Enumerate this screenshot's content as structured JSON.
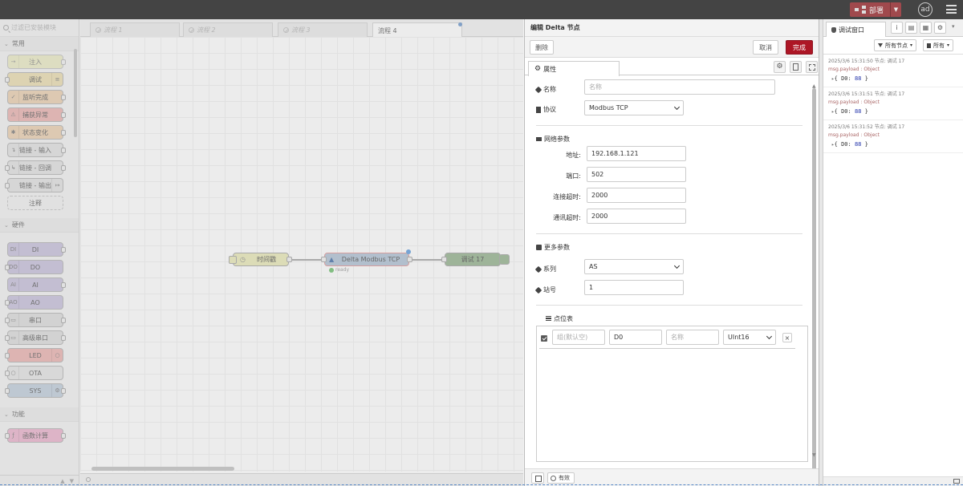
{
  "header": {
    "deploy_label": "部署",
    "user_initials": "ad"
  },
  "palette": {
    "search_placeholder": "过滤已安装模块",
    "categories": [
      {
        "label": "常用",
        "nodes": [
          "注入",
          "调试",
          "监听完成",
          "捕获异常",
          "状态变化",
          "链接 - 输入",
          "链接 - 回调",
          "链接 - 输出",
          "注释"
        ]
      },
      {
        "label": "硬件",
        "nodes": [
          "DI",
          "DO",
          "AI",
          "AO",
          "串口",
          "高级串口",
          "LED",
          "OTA",
          "SYS"
        ]
      },
      {
        "label": "功能",
        "nodes": [
          "函数计算"
        ]
      }
    ]
  },
  "workspace": {
    "tabs": [
      "流程 1",
      "流程 2",
      "流程 3",
      "流程 4"
    ],
    "nodes": {
      "inject": "时间戳",
      "delta": "Delta Modbus TCP",
      "debug": "调试 17"
    },
    "delta_status": "ready"
  },
  "tray": {
    "title": "编辑 Delta 节点",
    "delete_label": "删除",
    "cancel_label": "取消",
    "done_label": "完成",
    "tab_label": "属性",
    "name": {
      "label": "名称",
      "placeholder": "名称",
      "value": ""
    },
    "protocol": {
      "label": "协议",
      "value": "Modbus TCP"
    },
    "network_section": "网络参数",
    "address": {
      "label": "地址:",
      "value": "192.168.1.121"
    },
    "port": {
      "label": "端口:",
      "value": "502"
    },
    "connect_timeout": {
      "label": "连接超时:",
      "value": "2000"
    },
    "comm_timeout": {
      "label": "通讯超时:",
      "value": "2000"
    },
    "more_section": "更多参数",
    "series": {
      "label": "系列",
      "value": "AS"
    },
    "station": {
      "label": "站号",
      "value": "1"
    },
    "points_section": "点位表",
    "points_table": {
      "row": {
        "group_placeholder": "组(默认空)",
        "address": "D0",
        "name_placeholder": "名称",
        "type": "UInt16",
        "checked": true
      }
    },
    "footer_toggle_label": "有效"
  },
  "sidebar": {
    "tab_label": "调试窗口",
    "filter_nodes_label": "所有节点",
    "clear_label": "所有",
    "messages": [
      {
        "meta": "2025/3/6 15:31:50   节点: 调试 17",
        "topic": "msg.payload : Object",
        "key": "D0",
        "value": "88"
      },
      {
        "meta": "2025/3/6 15:31:51   节点: 调试 17",
        "topic": "msg.payload : Object",
        "key": "D0",
        "value": "88"
      },
      {
        "meta": "2025/3/6 15:31:52   节点: 调试 17",
        "topic": "msg.payload : Object",
        "key": "D0",
        "value": "88"
      }
    ]
  },
  "colors": {
    "accent": "#ad1625",
    "header": "#444444",
    "delta_node": "#a6bbcf",
    "inject_node": "#e7e7ae",
    "debug_node": "#87a980"
  }
}
